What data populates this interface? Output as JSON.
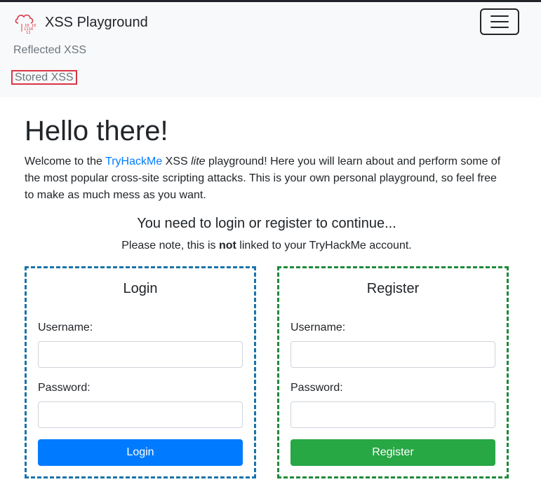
{
  "navbar": {
    "brand": "XSS Playground",
    "links": [
      {
        "label": "Reflected XSS"
      },
      {
        "label": "Stored XSS"
      }
    ]
  },
  "main": {
    "heading": "Hello there!",
    "intro": {
      "part1": "Welcome to the ",
      "link": "TryHackMe",
      "part2": " XSS ",
      "italic": "lite",
      "part3": " playground! Here you will learn about and perform some of the most popular cross-site scripting attacks. This is your own personal playground, so feel free to make as much mess as you want."
    },
    "need_login": "You need to login or register to continue...",
    "note": {
      "part1": "Please note, this is ",
      "bold": "not",
      "part2": " linked to your TryHackMe account."
    }
  },
  "login": {
    "title": "Login",
    "username_label": "Username:",
    "username_value": "",
    "password_label": "Password:",
    "password_value": "",
    "button": "Login"
  },
  "register": {
    "title": "Register",
    "username_label": "Username:",
    "username_value": "",
    "password_label": "Password:",
    "password_value": "",
    "button": "Register"
  },
  "colors": {
    "primary": "#007bff",
    "success": "#28a745",
    "highlight_border": "#dc3545",
    "login_card_border": "#1a74a8",
    "register_card_border": "#1e8a3a"
  },
  "icons": {
    "brand_logo": "cloud-binary-icon",
    "menu": "hamburger-menu-icon"
  }
}
